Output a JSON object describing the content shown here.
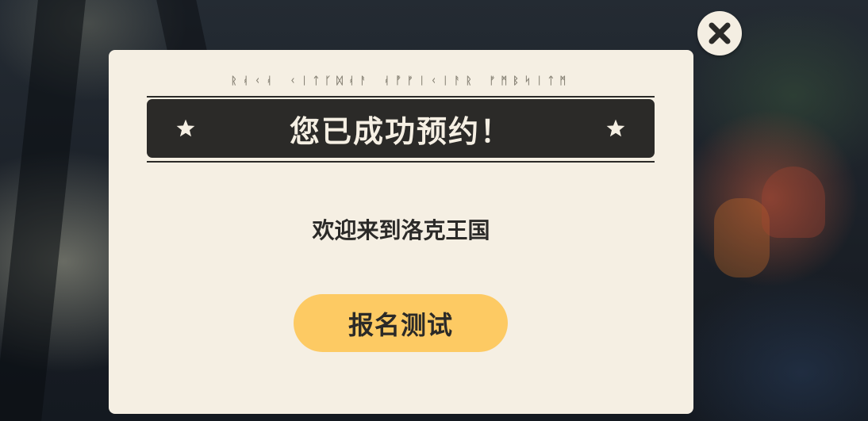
{
  "dialog": {
    "rune_text": "ᚱᚮᚲᚮ ᚲᛁᛏᚴᛞᚮᚨ ᚮᚡᚠᛁᚲᛁᚨᚱ ᚠᛗᛒᛋᛁᛏᛗ",
    "title": "您已成功预约！",
    "welcome": "欢迎来到洛克王国",
    "cta_label": "报名测试"
  },
  "icons": {
    "close": "close-icon",
    "star": "star-icon"
  },
  "colors": {
    "panel": "#f5efe3",
    "banner": "#2b2a28",
    "cta": "#fdca63",
    "text_dark": "#2b2a28"
  }
}
